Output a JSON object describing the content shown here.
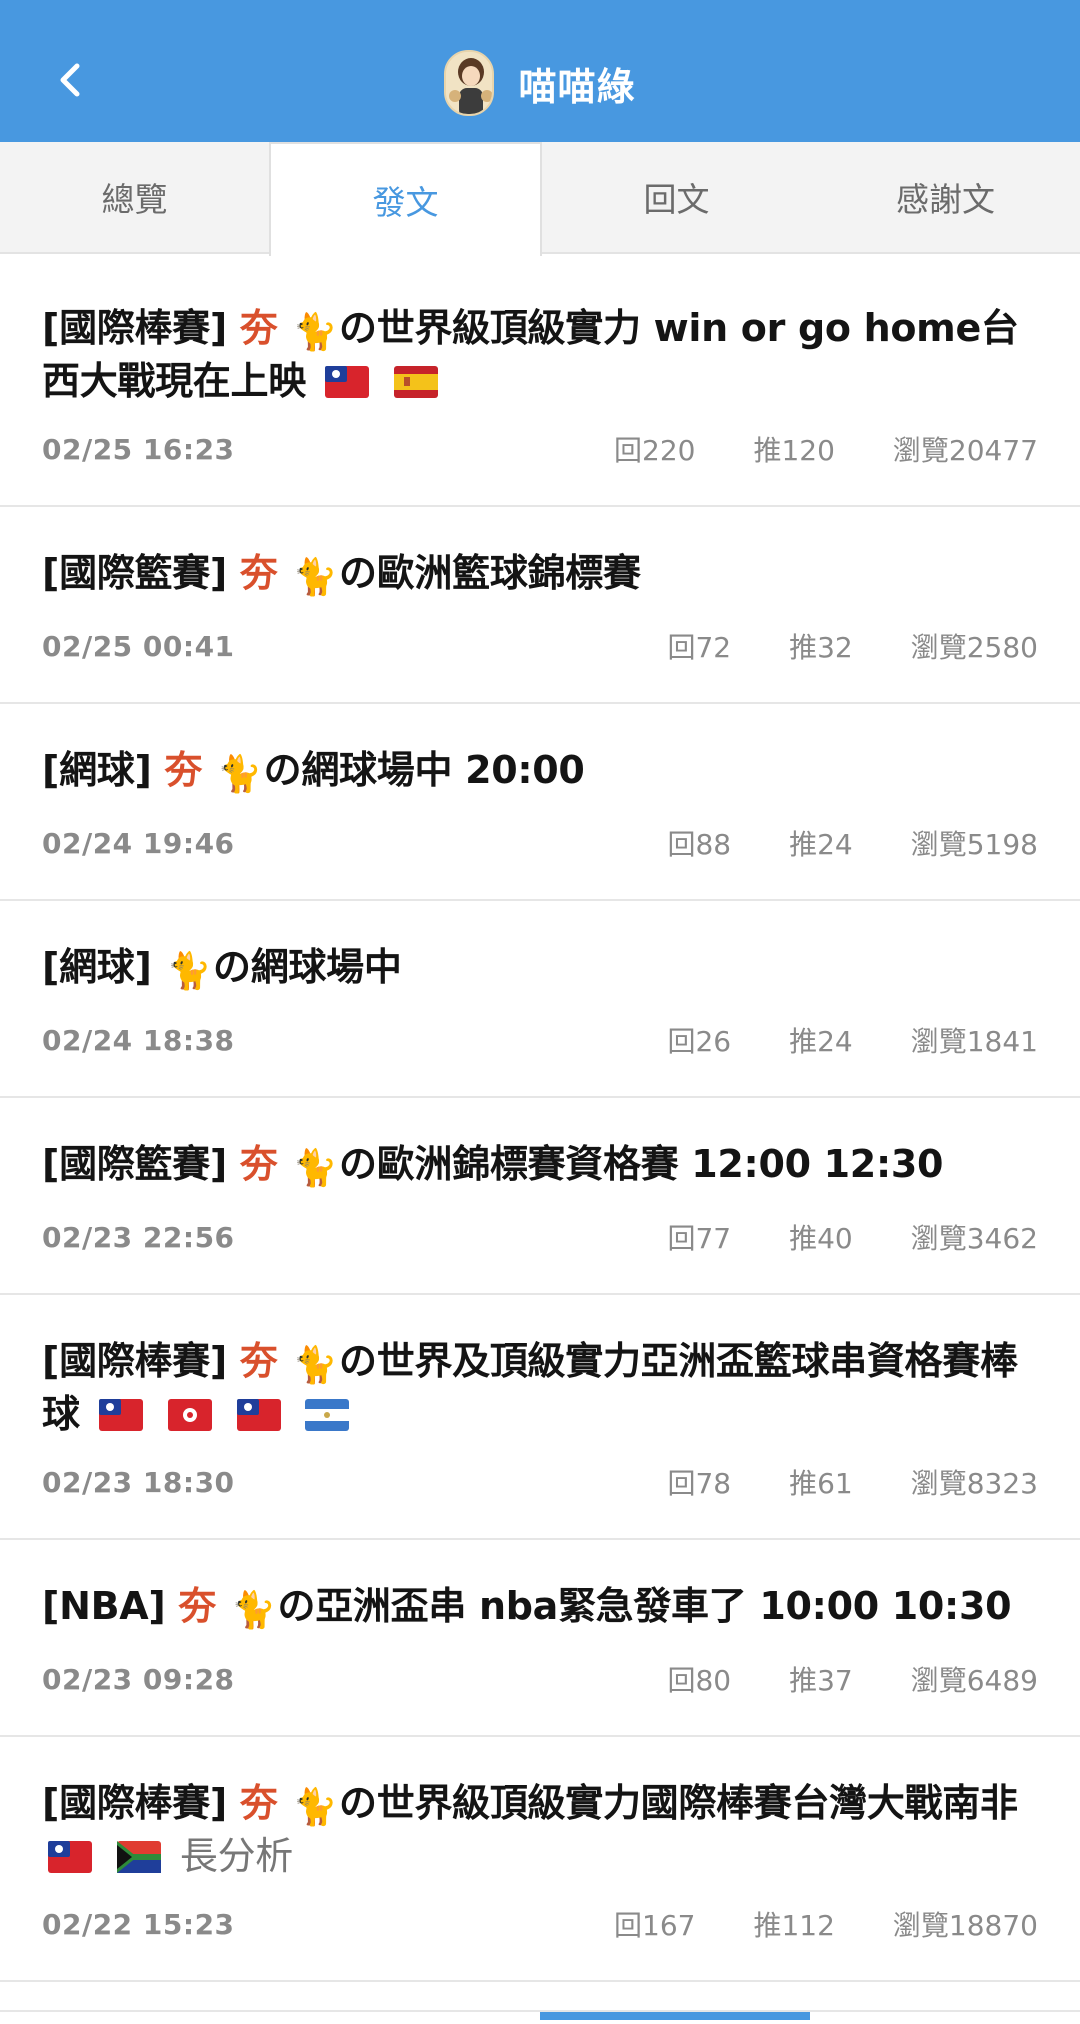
{
  "header": {
    "title": "喵喵綠",
    "back_icon": "chevron-left-icon",
    "bg_color": "#4898e0"
  },
  "tabs": [
    {
      "label": "總覽",
      "active": false
    },
    {
      "label": "發文",
      "active": true
    },
    {
      "label": "回文",
      "active": false
    },
    {
      "label": "感謝文",
      "active": false
    }
  ],
  "posts": [
    {
      "category": "[國際棒賽]",
      "tag": "夯",
      "title": "の世界級頂級實力 win or go home台西大戰現在上映",
      "flags": [
        "taiwan",
        "spain"
      ],
      "extra": "",
      "date": "02/25 16:23",
      "replies": "回220",
      "pushes": "推120",
      "views": "瀏覽20477"
    },
    {
      "category": "[國際籃賽]",
      "tag": "夯",
      "title": "の歐洲籃球錦標賽",
      "flags": [],
      "extra": "",
      "date": "02/25 00:41",
      "replies": "回72",
      "pushes": "推32",
      "views": "瀏覽2580"
    },
    {
      "category": "[網球]",
      "tag": "夯",
      "title": "の網球場中 20:00",
      "flags": [],
      "extra": "",
      "date": "02/24 19:46",
      "replies": "回88",
      "pushes": "推24",
      "views": "瀏覽5198"
    },
    {
      "category": "[網球]",
      "tag": "",
      "title": "の網球場中",
      "flags": [],
      "extra": "",
      "date": "02/24 18:38",
      "replies": "回26",
      "pushes": "推24",
      "views": "瀏覽1841"
    },
    {
      "category": "[國際籃賽]",
      "tag": "夯",
      "title": "の歐洲錦標賽資格賽 12:00 12:30",
      "flags": [],
      "extra": "",
      "date": "02/23 22:56",
      "replies": "回77",
      "pushes": "推40",
      "views": "瀏覽3462"
    },
    {
      "category": "[國際棒賽]",
      "tag": "夯",
      "title": "の世界及頂級實力亞洲盃籃球串資格賽棒球",
      "flags": [
        "taiwan",
        "hongkong",
        "taiwan",
        "nicaragua"
      ],
      "extra": "",
      "date": "02/23 18:30",
      "replies": "回78",
      "pushes": "推61",
      "views": "瀏覽8323"
    },
    {
      "category": "[NBA]",
      "tag": "夯",
      "title": "の亞洲盃串 nba緊急發車了 10:00 10:30",
      "flags": [],
      "extra": "",
      "date": "02/23 09:28",
      "replies": "回80",
      "pushes": "推37",
      "views": "瀏覽6489"
    },
    {
      "category": "[國際棒賽]",
      "tag": "夯",
      "title": "の世界級頂級實力國際棒賽台灣大戰南非",
      "flags": [
        "taiwan",
        "southafrica"
      ],
      "extra": "長分析",
      "date": "02/22 15:23",
      "replies": "回167",
      "pushes": "推112",
      "views": "瀏覽18870"
    }
  ]
}
